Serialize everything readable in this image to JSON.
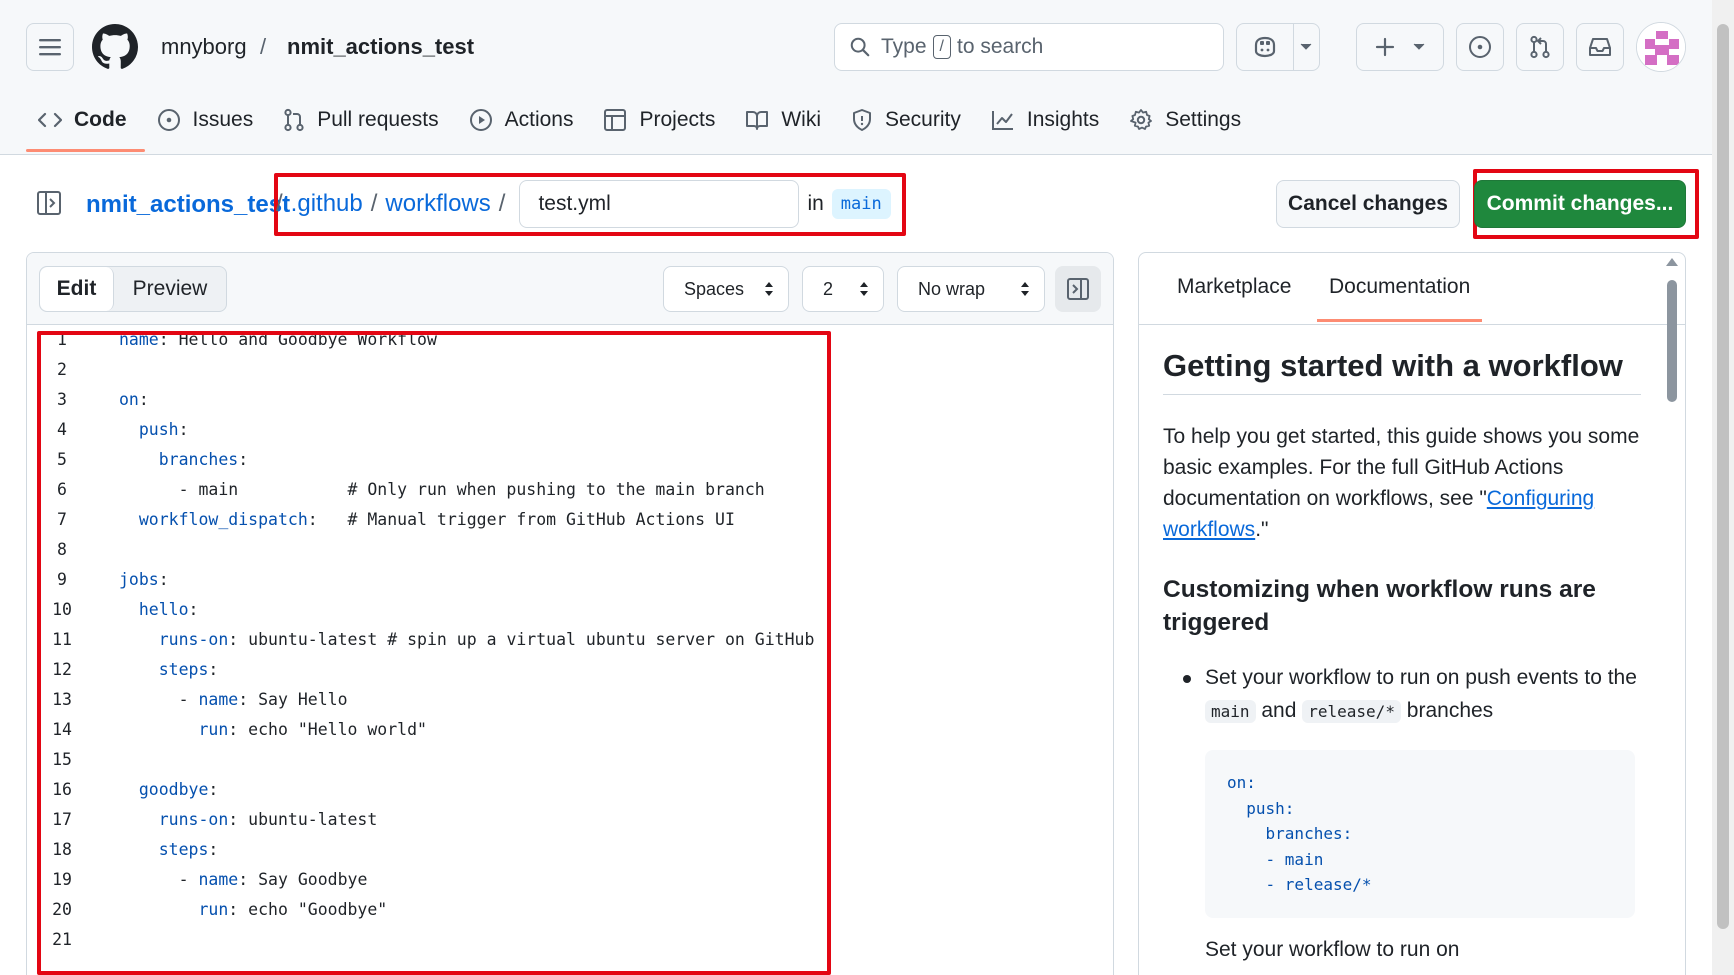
{
  "header": {
    "owner": "mnyborg",
    "separator": "/",
    "repo": "nmit_actions_test",
    "search": {
      "prefix": "Type",
      "key": "/",
      "suffix": "to search"
    }
  },
  "nav": {
    "tabs": [
      {
        "label": "Code",
        "icon": "code-icon"
      },
      {
        "label": "Issues",
        "icon": "issue-icon"
      },
      {
        "label": "Pull requests",
        "icon": "pull-request-icon"
      },
      {
        "label": "Actions",
        "icon": "play-icon"
      },
      {
        "label": "Projects",
        "icon": "table-icon"
      },
      {
        "label": "Wiki",
        "icon": "book-icon"
      },
      {
        "label": "Security",
        "icon": "shield-icon"
      },
      {
        "label": "Insights",
        "icon": "graph-icon"
      },
      {
        "label": "Settings",
        "icon": "gear-icon"
      }
    ],
    "active": "Code"
  },
  "path": {
    "repo": "nmit_actions_test",
    "sep": "/",
    "dir1": ".github",
    "dir2": "workflows",
    "filename": "test.yml",
    "in_label": "in",
    "branch": "main"
  },
  "actions": {
    "cancel": "Cancel changes",
    "commit": "Commit changes..."
  },
  "editor": {
    "tabs": {
      "edit": "Edit",
      "preview": "Preview"
    },
    "indent_mode": "Spaces",
    "indent_size": "2",
    "wrap_mode": "No wrap",
    "lines": [
      {
        "n": "1",
        "key": "name",
        "rest": ": Hello and Goodbye Workflow"
      },
      {
        "n": "2",
        "text": ""
      },
      {
        "n": "3",
        "key": "on",
        "rest": ":"
      },
      {
        "n": "4",
        "indent": "  ",
        "key": "push",
        "rest": ":"
      },
      {
        "n": "5",
        "indent": "    ",
        "key": "branches",
        "rest": ":"
      },
      {
        "n": "6",
        "text": "      - main           # Only run when pushing to the main branch"
      },
      {
        "n": "7",
        "indent": "  ",
        "key": "workflow_dispatch",
        "rest": ":   # Manual trigger from GitHub Actions UI"
      },
      {
        "n": "8",
        "text": ""
      },
      {
        "n": "9",
        "key": "jobs",
        "rest": ":"
      },
      {
        "n": "10",
        "indent": "  ",
        "key": "hello",
        "rest": ":"
      },
      {
        "n": "11",
        "indent": "    ",
        "key": "runs-on",
        "rest": ": ubuntu-latest # spin up a virtual ubuntu server on GitHub"
      },
      {
        "n": "12",
        "indent": "    ",
        "key": "steps",
        "rest": ":"
      },
      {
        "n": "13",
        "indent": "      - ",
        "key": "name",
        "rest": ": Say Hello"
      },
      {
        "n": "14",
        "indent": "        ",
        "key": "run",
        "rest": ": echo \"Hello world\""
      },
      {
        "n": "15",
        "text": ""
      },
      {
        "n": "16",
        "indent": "  ",
        "key": "goodbye",
        "rest": ":"
      },
      {
        "n": "17",
        "indent": "    ",
        "key": "runs-on",
        "rest": ": ubuntu-latest"
      },
      {
        "n": "18",
        "indent": "    ",
        "key": "steps",
        "rest": ":"
      },
      {
        "n": "19",
        "indent": "      - ",
        "key": "name",
        "rest": ": Say Goodbye"
      },
      {
        "n": "20",
        "indent": "        ",
        "key": "run",
        "rest": ": echo \"Goodbye\""
      },
      {
        "n": "21",
        "text": ""
      }
    ]
  },
  "docs": {
    "tabs": {
      "marketplace": "Marketplace",
      "documentation": "Documentation"
    },
    "title": "Getting started with a workflow",
    "intro_before": "To help you get started, this guide shows you some basic examples. For the full GitHub Actions documentation on workflows, see \"",
    "intro_link": "Configuring workflows",
    "intro_after": ".\"",
    "section_title": "Customizing when workflow runs are triggered",
    "bullet_before": "Set your workflow to run on push events to the ",
    "bullet_code1": "main",
    "bullet_mid": " and ",
    "bullet_code2": "release/*",
    "bullet_after": " branches",
    "example": "on:\n  push:\n    branches:\n    - main\n    - release/*",
    "cut_text": "Set your workflow to run on"
  },
  "colors": {
    "accent": "#0969da",
    "commit_green": "#1f883d",
    "highlight_red": "#e30613",
    "tab_underline": "#fd8c73",
    "yaml_key": "#0550ae"
  }
}
